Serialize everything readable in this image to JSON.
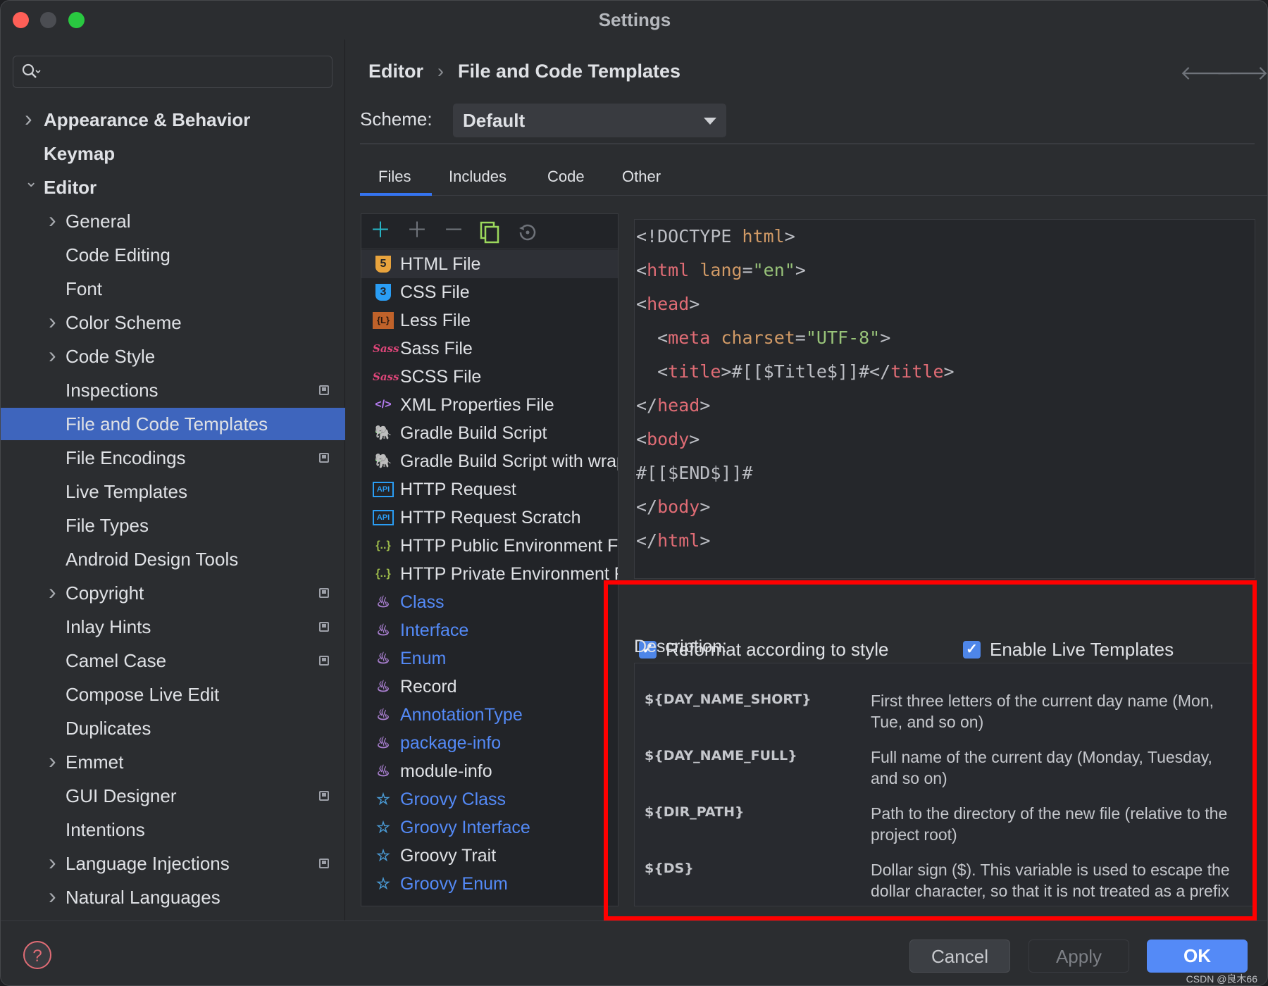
{
  "window": {
    "title": "Settings"
  },
  "search": {
    "placeholder": ""
  },
  "sidebar": {
    "items": [
      {
        "label": "Appearance & Behavior",
        "level": 0,
        "arrow": "›",
        "bold": true
      },
      {
        "label": "Keymap",
        "level": 0,
        "arrow": "",
        "bold": true
      },
      {
        "label": "Editor",
        "level": 0,
        "arrow": "⌄",
        "bold": true
      },
      {
        "label": "General",
        "level": 1,
        "arrow": "›"
      },
      {
        "label": "Code Editing",
        "level": 1,
        "arrow": ""
      },
      {
        "label": "Font",
        "level": 1,
        "arrow": ""
      },
      {
        "label": "Color Scheme",
        "level": 1,
        "arrow": "›"
      },
      {
        "label": "Code Style",
        "level": 1,
        "arrow": "›"
      },
      {
        "label": "Inspections",
        "level": 1,
        "arrow": "",
        "badge": true
      },
      {
        "label": "File and Code Templates",
        "level": 1,
        "arrow": "",
        "selected": true
      },
      {
        "label": "File Encodings",
        "level": 1,
        "arrow": "",
        "badge": true
      },
      {
        "label": "Live Templates",
        "level": 1,
        "arrow": ""
      },
      {
        "label": "File Types",
        "level": 1,
        "arrow": ""
      },
      {
        "label": "Android Design Tools",
        "level": 1,
        "arrow": ""
      },
      {
        "label": "Copyright",
        "level": 1,
        "arrow": "›",
        "badge": true
      },
      {
        "label": "Inlay Hints",
        "level": 1,
        "arrow": "",
        "badge": true
      },
      {
        "label": "Camel Case",
        "level": 1,
        "arrow": "",
        "badge": true
      },
      {
        "label": "Compose Live Edit",
        "level": 1,
        "arrow": ""
      },
      {
        "label": "Duplicates",
        "level": 1,
        "arrow": ""
      },
      {
        "label": "Emmet",
        "level": 1,
        "arrow": "›"
      },
      {
        "label": "GUI Designer",
        "level": 1,
        "arrow": "",
        "badge": true
      },
      {
        "label": "Intentions",
        "level": 1,
        "arrow": ""
      },
      {
        "label": "Language Injections",
        "level": 1,
        "arrow": "›",
        "badge": true
      },
      {
        "label": "Natural Languages",
        "level": 1,
        "arrow": "›"
      }
    ]
  },
  "breadcrumb": {
    "parent": "Editor",
    "separator": "›",
    "current": "File and Code Templates"
  },
  "scheme": {
    "label": "Scheme:",
    "value": "Default"
  },
  "tabs": [
    {
      "label": "Files",
      "active": true
    },
    {
      "label": "Includes"
    },
    {
      "label": "Code"
    },
    {
      "label": "Other"
    }
  ],
  "templates": [
    {
      "label": "HTML File",
      "icon": "html5-icon",
      "glyph": "5",
      "color": "#e8a33d",
      "selected": true
    },
    {
      "label": "CSS File",
      "icon": "css3-icon",
      "glyph": "3",
      "color": "#2a9df4"
    },
    {
      "label": "Less File",
      "icon": "less-icon",
      "glyph": "{L}",
      "color": "#c0622a"
    },
    {
      "label": "Sass File",
      "icon": "sass-icon",
      "glyph": "Sass",
      "color": "#e0467a"
    },
    {
      "label": "SCSS File",
      "icon": "sass-icon",
      "glyph": "Sass",
      "color": "#e0467a"
    },
    {
      "label": "XML Properties File",
      "icon": "xml-icon",
      "glyph": "</>",
      "color": "#b57cf0"
    },
    {
      "label": "Gradle Build Script",
      "icon": "gradle-elephant-icon",
      "glyph": "🐘",
      "color": "#3ea356"
    },
    {
      "label": "Gradle Build Script with wrapper",
      "icon": "gradle-elephant-icon",
      "glyph": "🐘",
      "color": "#3ea356"
    },
    {
      "label": "HTTP Request",
      "icon": "api-icon",
      "glyph": "API",
      "color": "#2a9df4"
    },
    {
      "label": "HTTP Request Scratch",
      "icon": "api-icon",
      "glyph": "API",
      "color": "#2a9df4"
    },
    {
      "label": "HTTP Public Environment File",
      "icon": "json-braces-icon",
      "glyph": "{..}",
      "color": "#9bb84a"
    },
    {
      "label": "HTTP Private Environment File",
      "icon": "json-braces-icon",
      "glyph": "{..}",
      "color": "#9bb84a"
    },
    {
      "label": "Class",
      "icon": "java-icon",
      "glyph": "♨",
      "color": "#a97fd0",
      "link": true
    },
    {
      "label": "Interface",
      "icon": "java-icon",
      "glyph": "♨",
      "color": "#a97fd0",
      "link": true
    },
    {
      "label": "Enum",
      "icon": "java-icon",
      "glyph": "♨",
      "color": "#a97fd0",
      "link": true
    },
    {
      "label": "Record",
      "icon": "java-icon",
      "glyph": "♨",
      "color": "#a97fd0"
    },
    {
      "label": "AnnotationType",
      "icon": "java-icon",
      "glyph": "♨",
      "color": "#a97fd0",
      "link": true
    },
    {
      "label": "package-info",
      "icon": "java-icon",
      "glyph": "♨",
      "color": "#a97fd0",
      "link": true
    },
    {
      "label": "module-info",
      "icon": "java-icon",
      "glyph": "♨",
      "color": "#a97fd0"
    },
    {
      "label": "Groovy Class",
      "icon": "groovy-icon",
      "glyph": "☆",
      "color": "#4a9bd6",
      "link": true
    },
    {
      "label": "Groovy Interface",
      "icon": "groovy-icon",
      "glyph": "☆",
      "color": "#4a9bd6",
      "link": true
    },
    {
      "label": "Groovy Trait",
      "icon": "groovy-icon",
      "glyph": "☆",
      "color": "#4a9bd6"
    },
    {
      "label": "Groovy Enum",
      "icon": "groovy-icon",
      "glyph": "☆",
      "color": "#4a9bd6",
      "link": true
    }
  ],
  "code": [
    [
      [
        "p",
        "<!DOCTYPE "
      ],
      [
        "a",
        "html"
      ],
      [
        "p",
        ">"
      ]
    ],
    [
      [
        "p",
        "<"
      ],
      [
        "t",
        "html"
      ],
      [
        "p",
        " "
      ],
      [
        "a",
        "lang"
      ],
      [
        "p",
        "="
      ],
      [
        "s",
        "\"en\""
      ],
      [
        "p",
        ">"
      ]
    ],
    [
      [
        "p",
        "<"
      ],
      [
        "t",
        "head"
      ],
      [
        "p",
        ">"
      ]
    ],
    [
      [
        "p",
        "  <"
      ],
      [
        "t",
        "meta"
      ],
      [
        "p",
        " "
      ],
      [
        "a",
        "charset"
      ],
      [
        "p",
        "="
      ],
      [
        "s",
        "\"UTF-8\""
      ],
      [
        "p",
        ">"
      ]
    ],
    [
      [
        "p",
        "  <"
      ],
      [
        "t",
        "title"
      ],
      [
        "p",
        ">#[[$Title$]]#</"
      ],
      [
        "t",
        "title"
      ],
      [
        "p",
        ">"
      ]
    ],
    [
      [
        "p",
        "</"
      ],
      [
        "t",
        "head"
      ],
      [
        "p",
        ">"
      ]
    ],
    [
      [
        "p",
        "<"
      ],
      [
        "t",
        "body"
      ],
      [
        "p",
        ">"
      ]
    ],
    [
      [
        "p",
        "#[[$END$]]#"
      ]
    ],
    [
      [
        "p",
        "</"
      ],
      [
        "t",
        "body"
      ],
      [
        "p",
        ">"
      ]
    ],
    [
      [
        "p",
        "</"
      ],
      [
        "t",
        "html"
      ],
      [
        "p",
        ">"
      ]
    ]
  ],
  "options": {
    "reformat": {
      "label": "Reformat according to style",
      "checked": true
    },
    "live_templates": {
      "label": "Enable Live Templates",
      "checked": true
    }
  },
  "description": {
    "label": "Description:",
    "rows": [
      {
        "var": "${DAY_NAME_SHORT}",
        "text": "First three letters of the current day name (Mon, Tue, and so on)"
      },
      {
        "var": "${DAY_NAME_FULL}",
        "text": "Full name of the current day (Monday, Tuesday, and so on)"
      },
      {
        "var": "${DIR_PATH}",
        "text": "Path to the directory of the new file (relative to the project root)"
      },
      {
        "var": "${DS}",
        "text": "Dollar sign ($). This variable is used to escape the dollar character, so that it is not treated as a prefix of a template variable."
      }
    ]
  },
  "buttons": {
    "cancel": "Cancel",
    "apply": "Apply",
    "ok": "OK",
    "help": "?"
  },
  "watermark": "CSDN @良木66",
  "colors": {
    "accent": "#3574f0",
    "selection": "#3e65bd",
    "highlight_box": "#ff0000",
    "ok_button": "#548af7"
  }
}
